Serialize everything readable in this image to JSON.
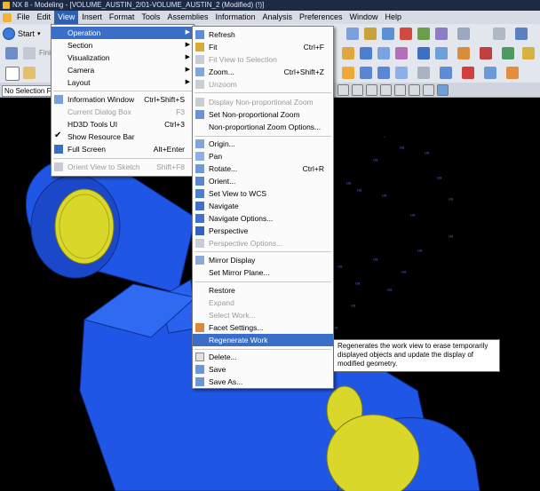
{
  "window": {
    "title": "NX 8 - Modeling - [VOLUME_AUSTIN_2/01-VOLUME_AUSTIN_2 (Modified)   (!)]"
  },
  "menubar": [
    "File",
    "Edit",
    "View",
    "Insert",
    "Format",
    "Tools",
    "Assemblies",
    "Information",
    "Analysis",
    "Preferences",
    "Window",
    "Help"
  ],
  "toolbar": {
    "start_label": "Start",
    "finish_label": "Fini"
  },
  "selection_filter": "No Selection F",
  "view_menu": [
    {
      "label": "Operation",
      "arrow": true,
      "highlighted": true
    },
    {
      "label": "Section",
      "arrow": true
    },
    {
      "label": "Visualization",
      "arrow": true
    },
    {
      "label": "Camera",
      "arrow": true
    },
    {
      "label": "Layout",
      "arrow": true
    },
    {
      "sep": true
    },
    {
      "label": "Information Window",
      "shortcut": "Ctrl+Shift+S"
    },
    {
      "label": "Current Dialog Box",
      "shortcut": "F3",
      "disabled": true
    },
    {
      "label": "HD3D Tools UI",
      "shortcut": "Ctrl+3"
    },
    {
      "label": "Show Resource Bar",
      "checked": true
    },
    {
      "label": "Full Screen",
      "shortcut": "Alt+Enter"
    },
    {
      "sep": true
    },
    {
      "label": "Orient View to Sketch",
      "shortcut": "Shift+F8",
      "disabled": true
    }
  ],
  "operation_menu": [
    {
      "label": "Refresh",
      "icon": "refresh-icon"
    },
    {
      "label": "Fit",
      "shortcut": "Ctrl+F",
      "icon": "fit-icon"
    },
    {
      "label": "Fit View to Selection",
      "disabled": true,
      "icon": "fit-selection-icon"
    },
    {
      "label": "Zoom...",
      "shortcut": "Ctrl+Shift+Z",
      "icon": "zoom-icon"
    },
    {
      "label": "Unzoom",
      "disabled": true,
      "icon": "unzoom-icon"
    },
    {
      "sep": true
    },
    {
      "label": "Display Non-proportional Zoom",
      "disabled": true,
      "icon": "nonprop-zoom-icon"
    },
    {
      "label": "Set Non-proportional Zoom",
      "icon": "set-nonprop-zoom-icon"
    },
    {
      "label": "Non-proportional Zoom Options..."
    },
    {
      "sep": true
    },
    {
      "label": "Origin...",
      "icon": "origin-icon"
    },
    {
      "label": "Pan",
      "icon": "pan-icon"
    },
    {
      "label": "Rotate...",
      "shortcut": "Ctrl+R",
      "icon": "rotate-icon"
    },
    {
      "label": "Orient...",
      "icon": "orient-icon"
    },
    {
      "label": "Set View to WCS",
      "icon": "wcs-icon"
    },
    {
      "label": "Navigate",
      "icon": "navigate-icon"
    },
    {
      "label": "Navigate Options...",
      "icon": "navigate-options-icon"
    },
    {
      "label": "Perspective",
      "icon": "perspective-icon"
    },
    {
      "label": "Perspective Options...",
      "disabled": true,
      "icon": "perspective-options-icon"
    },
    {
      "sep": true
    },
    {
      "label": "Mirror Display",
      "icon": "mirror-display-icon"
    },
    {
      "label": "Set Mirror Plane..."
    },
    {
      "sep": true
    },
    {
      "label": "Restore"
    },
    {
      "label": "Expand",
      "disabled": true
    },
    {
      "label": "Select Work...",
      "disabled": true
    },
    {
      "label": "Facet Settings...",
      "icon": "facet-settings-icon"
    },
    {
      "label": "Regenerate Work",
      "highlighted": true
    },
    {
      "sep": true
    },
    {
      "label": "Delete...",
      "icon": "delete-icon"
    },
    {
      "label": "Save",
      "icon": "save-icon"
    },
    {
      "label": "Save As...",
      "icon": "save-as-icon"
    }
  ],
  "tooltip": "Regenerates the work view to erase temporarily displayed objects and update the display of modified geometry.",
  "colors": {
    "model_blue": "#1f56e6",
    "model_yellow": "#d9d82a",
    "menu_highlight": "#3a6fc8",
    "menubar_active": "#2f5fb0"
  }
}
